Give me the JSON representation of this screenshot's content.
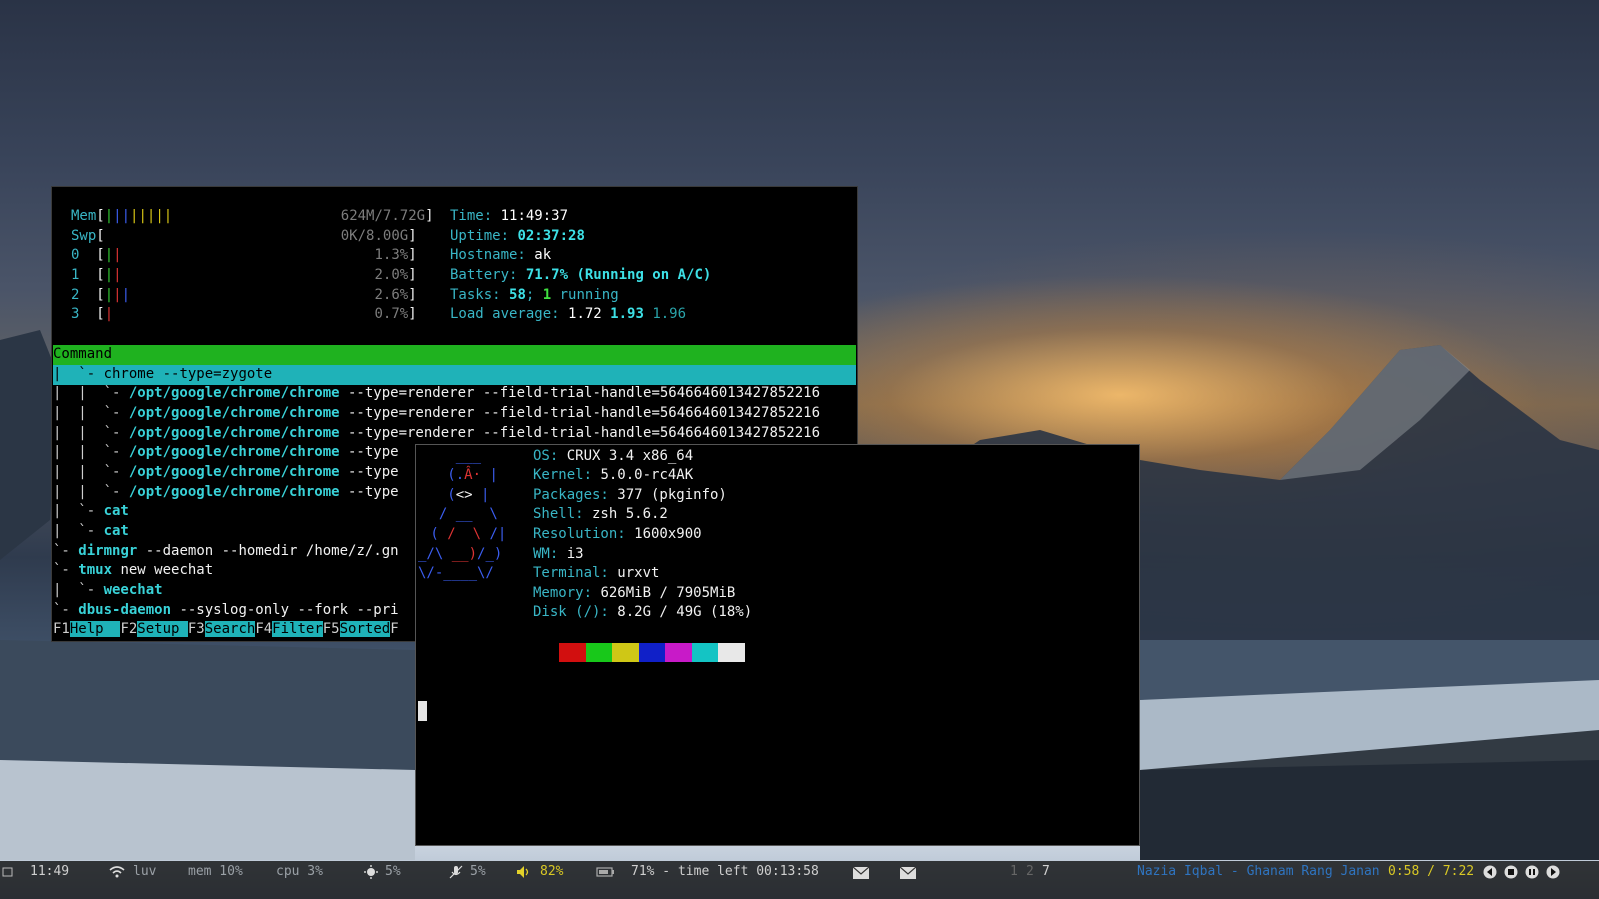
{
  "colors": {
    "terminal_bg": "#000000",
    "htop_header_bar": "#1fb21f",
    "htop_selected_bar": "#1fb2b8",
    "fkey_button": "#1fb2b8"
  },
  "htop": {
    "meters": [
      {
        "label": "Mem",
        "bars": "||||||||",
        "bar_colors": [
          "green",
          "blue",
          "blue",
          "yellow",
          "yellow",
          "yellow",
          "yellow",
          "yellow"
        ],
        "value": "624M/7.72G"
      },
      {
        "label": "Swp",
        "bars": "",
        "value": "0K/8.00G"
      },
      {
        "label": "0",
        "bars": "||",
        "value": "1.3%"
      },
      {
        "label": "1",
        "bars": "||",
        "value": "2.0%"
      },
      {
        "label": "2",
        "bars": "|||",
        "value": "2.6%"
      },
      {
        "label": "3",
        "bars": "|",
        "value": "0.7%"
      }
    ],
    "info": {
      "time_label": "Time:",
      "time_value": "11:49:37",
      "uptime_label": "Uptime:",
      "uptime_value": "02:37:28",
      "hostname_label": "Hostname:",
      "hostname_value": "ak",
      "battery_label": "Battery:",
      "battery_value": "71.7% (Running on A/C)",
      "tasks_label": "Tasks:",
      "tasks_total": "58",
      "tasks_sep": ";",
      "tasks_running": "1",
      "tasks_running_label": "running",
      "load_label": "Load average:",
      "load_1": "1.72",
      "load_5": "1.93",
      "load_15": "1.96"
    },
    "column_header": "Command",
    "processes": [
      {
        "prefix": "|  `- ",
        "cmd": "chrome",
        "args": " --type=zygote",
        "selected": true
      },
      {
        "prefix": "|  |  `- ",
        "cmd": "/opt/google/chrome/chrome",
        "args": " --type=renderer --field-trial-handle=5646646013427852216"
      },
      {
        "prefix": "|  |  `- ",
        "cmd": "/opt/google/chrome/chrome",
        "args": " --type=renderer --field-trial-handle=5646646013427852216"
      },
      {
        "prefix": "|  |  `- ",
        "cmd": "/opt/google/chrome/chrome",
        "args": " --type=renderer --field-trial-handle=5646646013427852216"
      },
      {
        "prefix": "|  |  `- ",
        "cmd": "/opt/google/chrome/chrome",
        "args": " --type"
      },
      {
        "prefix": "|  |  `- ",
        "cmd": "/opt/google/chrome/chrome",
        "args": " --type"
      },
      {
        "prefix": "|  |  `- ",
        "cmd": "/opt/google/chrome/chrome",
        "args": " --type"
      },
      {
        "prefix": "|  `- ",
        "cmd": "cat",
        "args": ""
      },
      {
        "prefix": "|  `- ",
        "cmd": "cat",
        "args": ""
      },
      {
        "prefix": "`- ",
        "cmd": "dirmngr",
        "args": " --daemon --homedir /home/z/.gn"
      },
      {
        "prefix": "`- ",
        "cmd": "tmux",
        "args": " new weechat"
      },
      {
        "prefix": "|  `- ",
        "cmd": "weechat",
        "args": ""
      },
      {
        "prefix": "`- ",
        "cmd": "dbus-daemon",
        "args": " --syslog-only --fork --pri"
      }
    ],
    "function_keys": [
      {
        "key": "F1",
        "label": "Help  "
      },
      {
        "key": "F2",
        "label": "Setup "
      },
      {
        "key": "F3",
        "label": "Search"
      },
      {
        "key": "F4",
        "label": "Filter"
      },
      {
        "key": "F5",
        "label": "Sorted"
      },
      {
        "key": "F",
        "label": ""
      }
    ]
  },
  "fetch": {
    "logo": [
      "    ___",
      "   (.Â· |",
      "   (<> |",
      "  / __  \\",
      " ( /  \\ /|",
      "_/\\ __)/_)",
      "\\/-____\\/"
    ],
    "lines": [
      {
        "label": "OS:",
        "value": " CRUX 3.4 x86_64"
      },
      {
        "label": "Kernel:",
        "value": " 5.0.0-rc4AK"
      },
      {
        "label": "Packages:",
        "value": " 377 (pkginfo)"
      },
      {
        "label": "Shell:",
        "value": " zsh 5.6.2"
      },
      {
        "label": "Resolution:",
        "value": " 1600x900"
      },
      {
        "label": "WM:",
        "value": " i3"
      },
      {
        "label": "Terminal:",
        "value": " urxvt"
      },
      {
        "label": "Memory:",
        "value": " 626MiB / 7905MiB"
      },
      {
        "label": "Disk (/):",
        "value": " 8.2G / 49G (18%)"
      }
    ],
    "palette": [
      "#d20f0f",
      "#18c81a",
      "#cfc716",
      "#1020c8",
      "#c81ac8",
      "#14c4c4",
      "#e8e8e8"
    ]
  },
  "statusbar": {
    "clock": "11:49",
    "wifi": "luv",
    "mem": "mem 10%",
    "cpu": "cpu 3%",
    "brightness": "5%",
    "mic": "5%",
    "volume": "82%",
    "battery": "71% - time left 00:13:58",
    "workspaces": [
      "1",
      "2",
      "7"
    ],
    "now_playing": "Nazia Iqbal - Ghanam Rang Janan",
    "position": "0:58 / 7:22"
  }
}
